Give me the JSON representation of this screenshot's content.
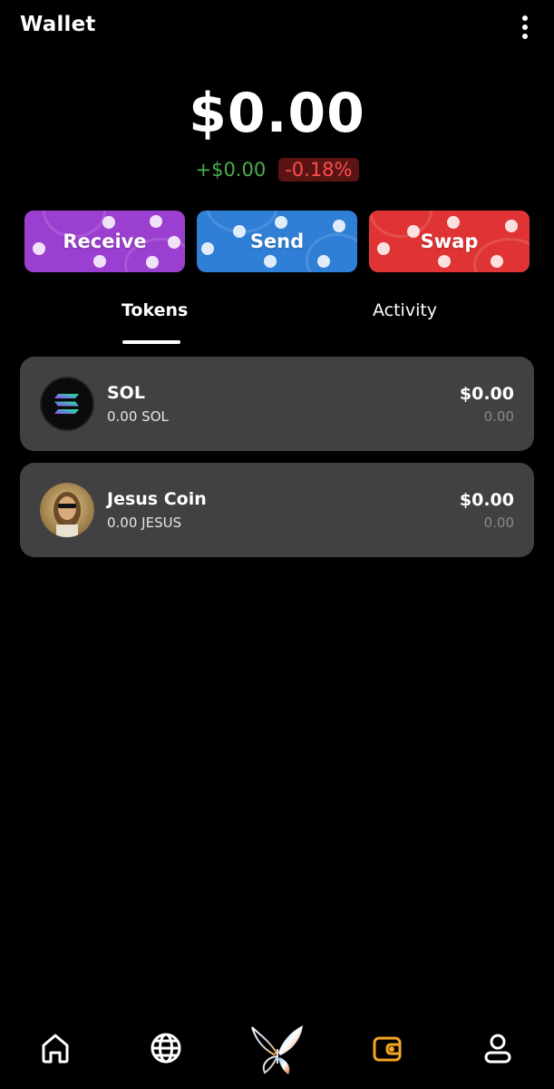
{
  "header": {
    "title": "Wallet",
    "menu_icon": "more-vertical-icon"
  },
  "balance": {
    "total": "$0.00",
    "change_abs": "+$0.00",
    "change_pct": "-0.18%"
  },
  "colors": {
    "positive": "#4cae4c",
    "negative": "#ff4d4d",
    "receive": "#9b3fd0",
    "send": "#2f7fd6",
    "swap": "#e03434",
    "active_nav": "#f5a623"
  },
  "actions": [
    {
      "label": "Receive"
    },
    {
      "label": "Send"
    },
    {
      "label": "Swap"
    }
  ],
  "tabs": [
    {
      "label": "Tokens",
      "active": true
    },
    {
      "label": "Activity",
      "active": false
    }
  ],
  "tokens": [
    {
      "name": "SOL",
      "amount": "0.00 SOL",
      "value": "$0.00",
      "sub_value": "0.00",
      "icon": "solana-logo-icon"
    },
    {
      "name": "Jesus Coin",
      "amount": "0.00 JESUS",
      "value": "$0.00",
      "sub_value": "0.00",
      "icon": "jesus-coin-avatar-icon"
    }
  ],
  "nav": [
    {
      "icon": "home-icon"
    },
    {
      "icon": "globe-icon"
    },
    {
      "icon": "butterfly-logo-icon"
    },
    {
      "icon": "wallet-icon",
      "active": true
    },
    {
      "icon": "profile-icon"
    }
  ]
}
